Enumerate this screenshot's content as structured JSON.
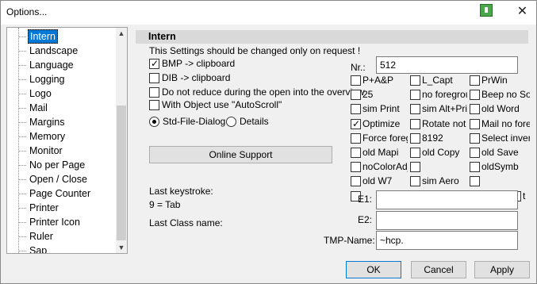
{
  "window": {
    "title": "Options..."
  },
  "tree": {
    "items": [
      {
        "label": "Intern",
        "selected": true
      },
      {
        "label": "Landscape"
      },
      {
        "label": "Language"
      },
      {
        "label": "Logging"
      },
      {
        "label": "Logo"
      },
      {
        "label": "Mail"
      },
      {
        "label": "Margins"
      },
      {
        "label": "Memory"
      },
      {
        "label": "Monitor"
      },
      {
        "label": "No per Page"
      },
      {
        "label": "Open / Close"
      },
      {
        "label": "Page Counter"
      },
      {
        "label": "Printer"
      },
      {
        "label": "Printer Icon"
      },
      {
        "label": "Ruler"
      },
      {
        "label": "Sap"
      }
    ]
  },
  "section": {
    "title": "Intern",
    "note": "This Settings should be changed only on request !"
  },
  "options": {
    "bmp": {
      "label": "BMP -> clipboard",
      "checked": true
    },
    "dib": {
      "label": "DIB -> clipboard",
      "checked": false
    },
    "no_reduce": {
      "label": "Do not reduce during the open into the overview",
      "checked": false
    },
    "autoscroll": {
      "label": "With Object use \"AutoScroll\"",
      "checked": false
    }
  },
  "radios": {
    "std": {
      "label": "Std-File-Dialog",
      "selected": true
    },
    "details": {
      "label": "Details",
      "selected": false
    }
  },
  "online_support": "Online Support",
  "last_keystroke": {
    "label": "Last keystroke:",
    "value": "9 = Tab"
  },
  "last_class": {
    "label": "Last Class name:"
  },
  "nr": {
    "label": "Nr.:",
    "value": "512"
  },
  "grid": [
    [
      "P+A&P",
      "L_Capt",
      "PrWin"
    ],
    [
      "25",
      "no foregrour",
      "Beep no Sou"
    ],
    [
      "sim Print",
      "sim Alt+Print",
      "old Word"
    ],
    [
      "Optimize",
      "Rotate not l",
      "Mail no foreg"
    ],
    [
      "Force foregr",
      "8192",
      "Select invers"
    ],
    [
      "old Mapi",
      "old Copy",
      "old Save"
    ],
    [
      "noColorAdj",
      "",
      "oldSymb"
    ],
    [
      "old W7",
      "sim Aero",
      ""
    ],
    [
      "",
      "",
      "",
      "",
      "nt",
      "t"
    ]
  ],
  "grid_checked": {
    "row": 3,
    "col": 0
  },
  "e1": {
    "label": "E1:",
    "value": ""
  },
  "e2": {
    "label": "E2:",
    "value": ""
  },
  "tmp": {
    "label": "TMP-Name:",
    "value": "~hcp."
  },
  "buttons": {
    "ok": "OK",
    "cancel": "Cancel",
    "apply": "Apply"
  },
  "icons": {
    "close": "close-icon",
    "app": "app-icon"
  }
}
